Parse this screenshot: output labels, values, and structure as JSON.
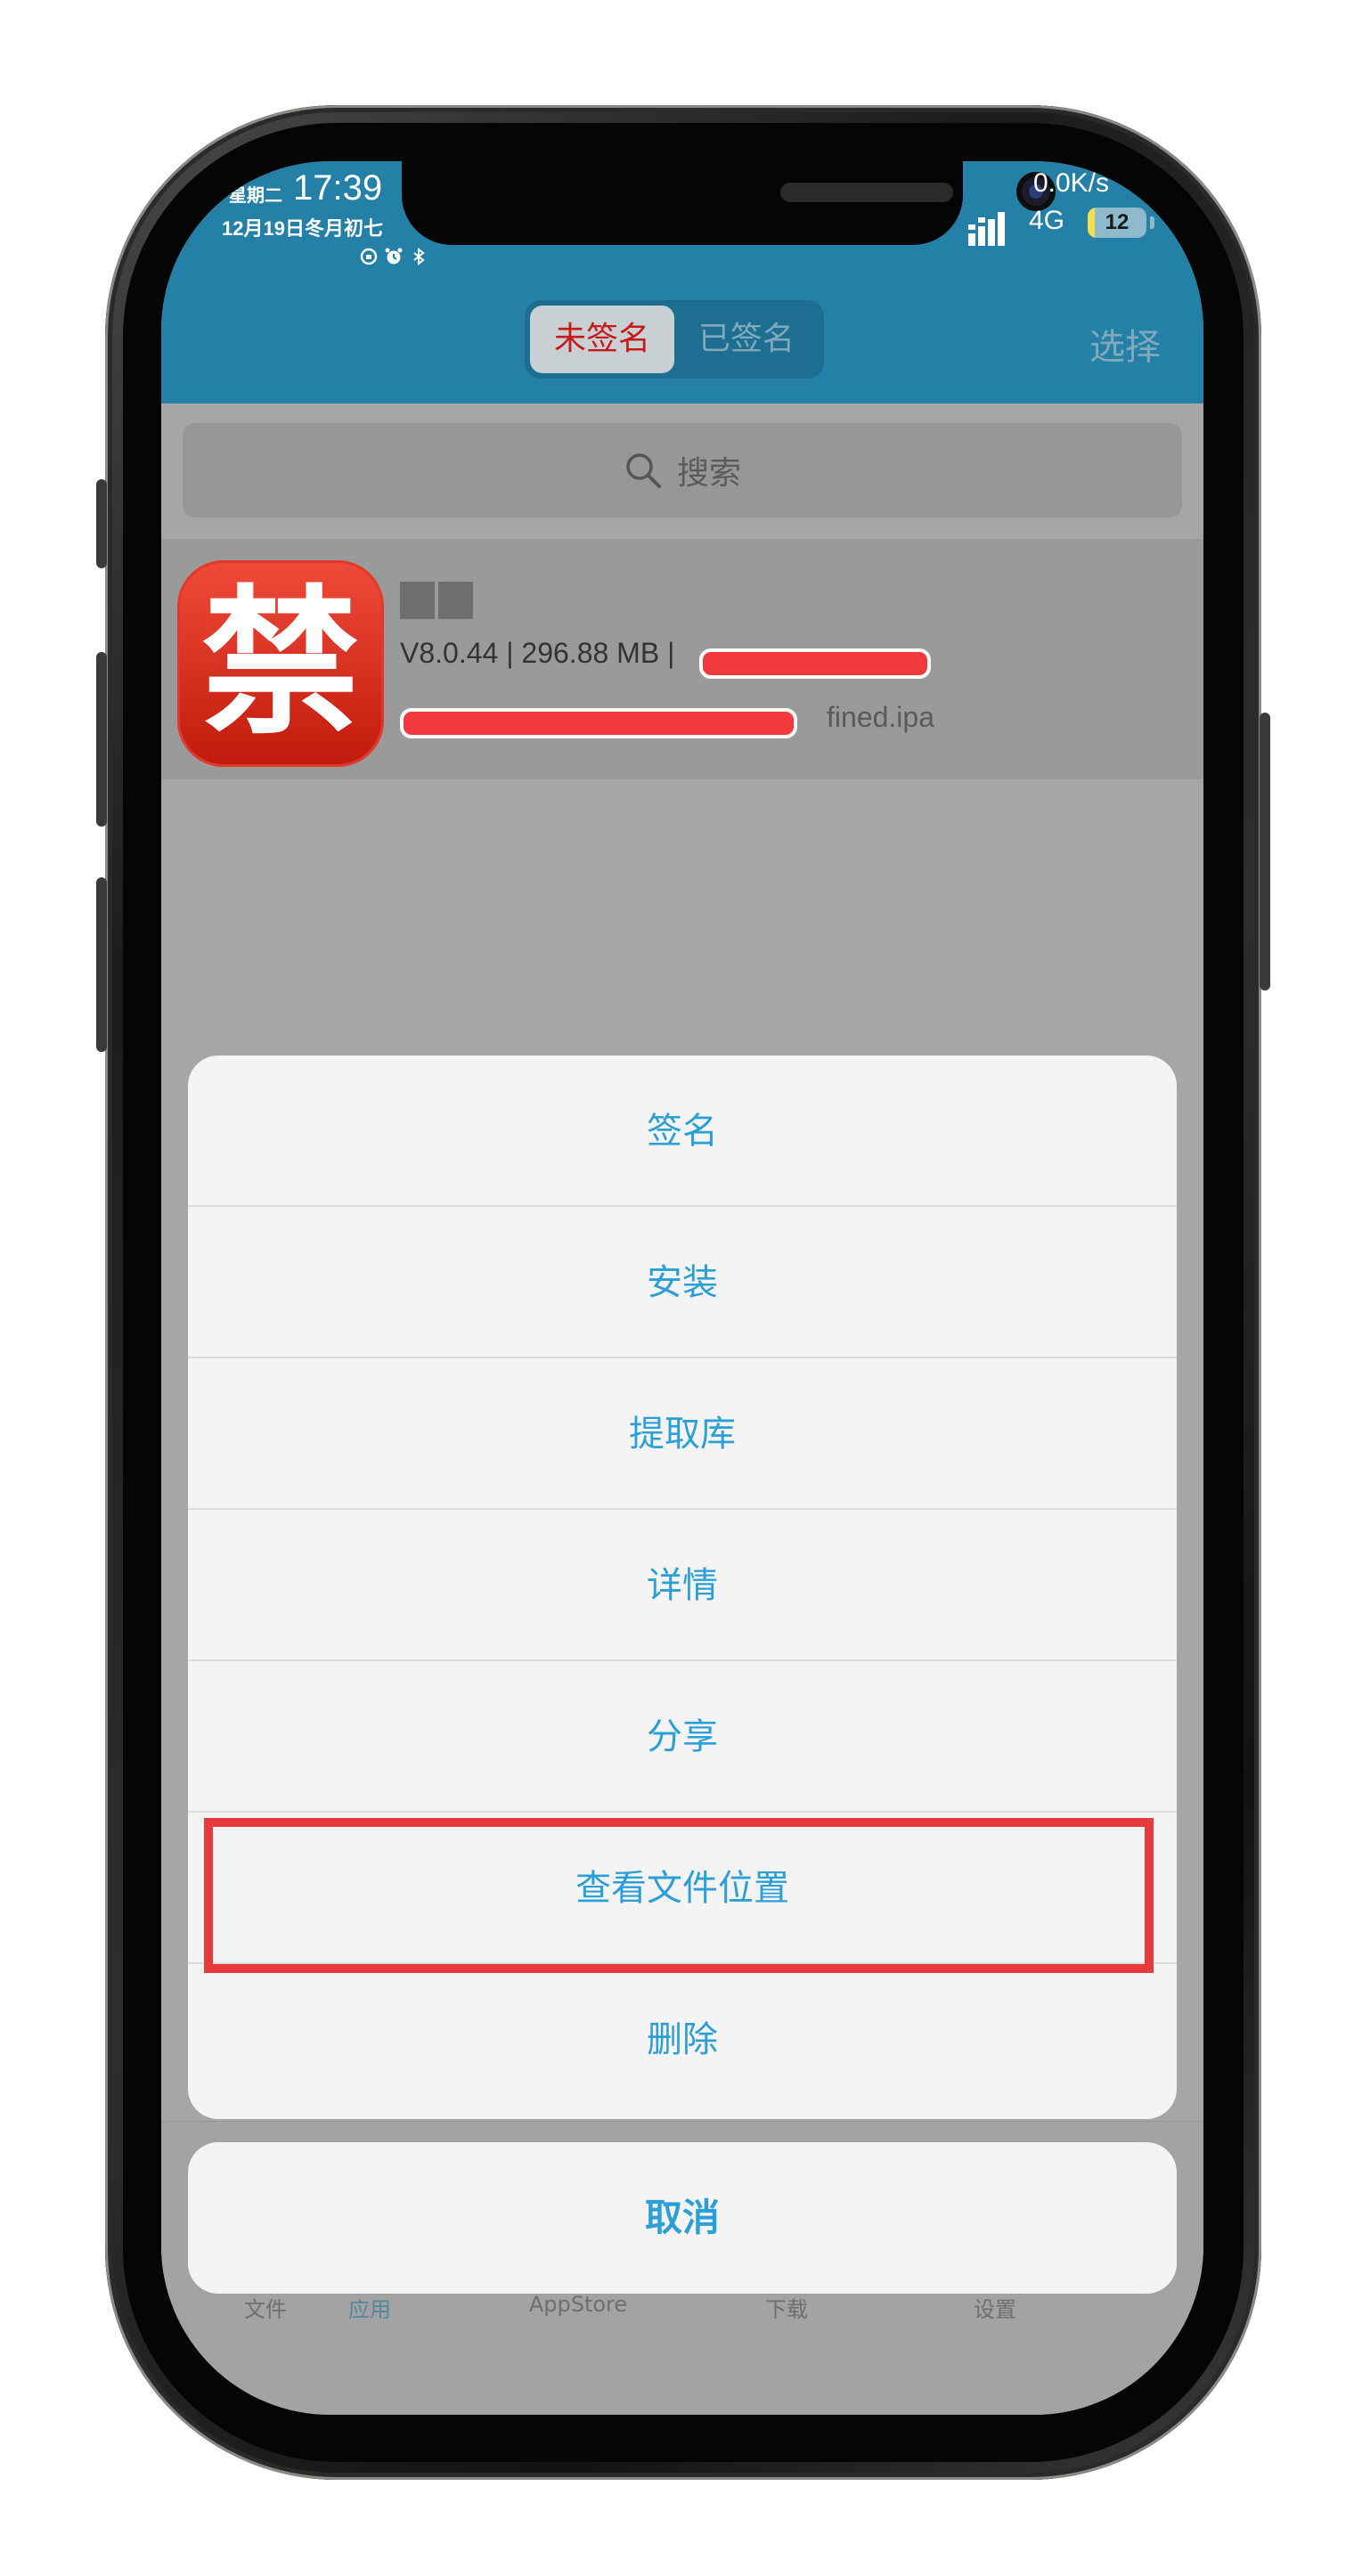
{
  "status_bar": {
    "weekday": "星期二",
    "time": "17:39",
    "date": "12月19日冬月初七",
    "net_speed": "0.0K/s",
    "network": "4G",
    "battery": "12",
    "battery_level": 0.12,
    "icons": [
      "lock-rotation-icon",
      "alarm-icon",
      "bluetooth-icon"
    ]
  },
  "header": {
    "segments": [
      "未签名",
      "已签名"
    ],
    "selected_segment": 0,
    "action": "选择"
  },
  "search": {
    "placeholder": "搜索"
  },
  "app_item": {
    "icon_glyph": "禁",
    "meta": "V8.0.44 | 296.88 MB |",
    "file_suffix": "fined.ipa"
  },
  "action_sheet": {
    "items": [
      "签名",
      "安装",
      "提取库",
      "详情",
      "分享",
      "查看文件位置",
      "删除"
    ],
    "highlighted_index": 5,
    "cancel": "取消"
  },
  "tab_bar": {
    "tabs": [
      "文件",
      "应用",
      "AppStore",
      "下载",
      "设置"
    ],
    "active_index": 1
  },
  "colors": {
    "header_bg": "#2480a6",
    "accent_blue": "#2c9fd6",
    "highlight_red": "#e83a3d",
    "selected_segment_text": "#c61a1a"
  }
}
